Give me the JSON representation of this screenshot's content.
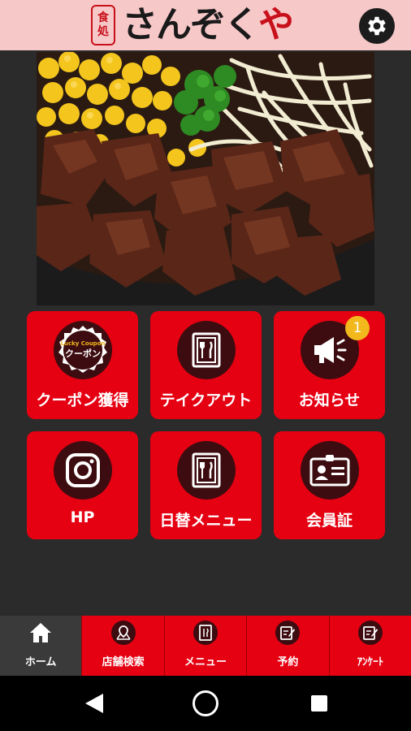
{
  "header": {
    "logo_seal_line1": "食",
    "logo_seal_line2": "処",
    "logo_text_main": "さんぞく",
    "logo_text_accent": "や",
    "settings_icon": "gear-icon"
  },
  "hero": {
    "icon": "food-photo"
  },
  "tiles": [
    {
      "label": "クーポン獲得",
      "icon": "coupon-icon",
      "coupon_top": "Lucky Coupon",
      "coupon_bottom": "クーポン"
    },
    {
      "label": "テイクアウト",
      "icon": "menu-book-icon"
    },
    {
      "label": "お知らせ",
      "icon": "megaphone-icon",
      "badge": "1"
    },
    {
      "label": "HP",
      "icon": "instagram-icon"
    },
    {
      "label": "日替メニュー",
      "icon": "menu-book-icon"
    },
    {
      "label": "会員証",
      "icon": "member-card-icon"
    }
  ],
  "nav": [
    {
      "label": "ホーム",
      "icon": "home-icon",
      "active": true
    },
    {
      "label": "店舗検索",
      "icon": "map-pin-icon"
    },
    {
      "label": "メニュー",
      "icon": "menu-book-icon"
    },
    {
      "label": "予約",
      "icon": "pencil-form-icon"
    },
    {
      "label": "ｱﾝｹｰﾄ",
      "icon": "pencil-form-icon"
    }
  ],
  "colors": {
    "header_bg": "#f7c8c8",
    "accent": "#e50012",
    "icon_circle": "#3d0c10",
    "page_bg": "#2b2b2b",
    "badge": "#f2b81c"
  }
}
